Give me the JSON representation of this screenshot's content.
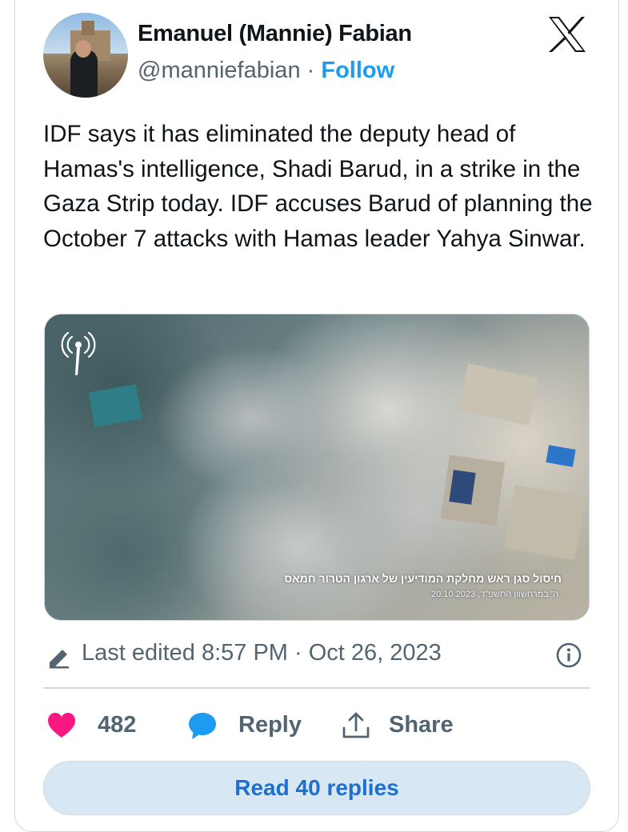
{
  "author": {
    "display_name": "Emanuel (Mannie) Fabian",
    "handle": "@manniefabian",
    "separator": "·",
    "follow_label": "Follow"
  },
  "brand": {
    "logo_icon": "x-logo-icon"
  },
  "tweet": {
    "text": "IDF says it has eliminated the deputy head of Hamas's intelligence, Shadi Barud, in a strike in the Gaza Strip today. IDF accuses Barud of planning the October 7 attacks with Hamas leader Yahya Sinwar."
  },
  "media": {
    "overlay_caption": "חיסול סגן ראש מחלקת המודיעין של ארגון הטרור חמאס",
    "overlay_date": "20.10.2023 ,ה' במרחשוון התשפ\"ד"
  },
  "meta": {
    "edited_label": "Last edited 8:57 PM · Oct 26, 2023"
  },
  "actions": {
    "like_count": "482",
    "reply_label": "Reply",
    "share_label": "Share"
  },
  "read_replies_label": "Read 40 replies",
  "colors": {
    "accent": "#1d9bf0",
    "like": "#f91880",
    "reply_icon": "#1d9bf0",
    "button_bg": "#d7e7f3",
    "muted_text": "#536471"
  }
}
